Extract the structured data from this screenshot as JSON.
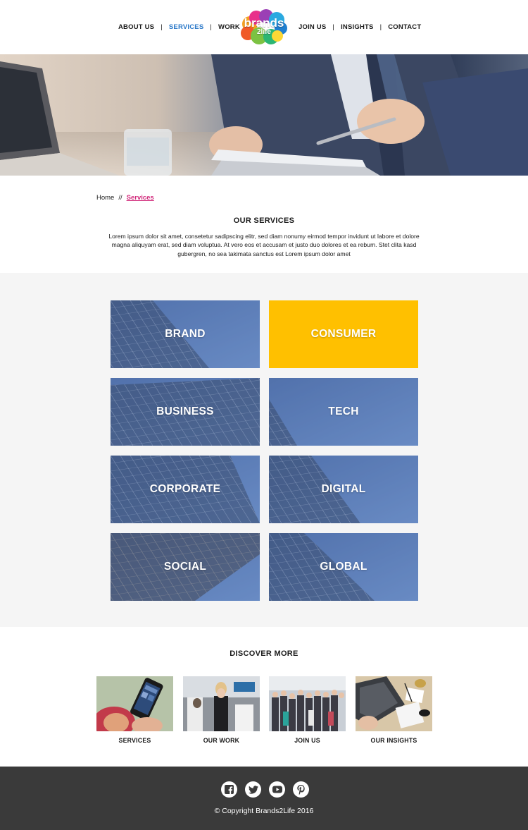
{
  "nav": {
    "left": [
      {
        "label": "ABOUT US",
        "active": false
      },
      {
        "label": "SERVICES",
        "active": true
      },
      {
        "label": "WORK",
        "active": false
      }
    ],
    "right": [
      {
        "label": "JOIN US",
        "active": false
      },
      {
        "label": "INSIGHTS",
        "active": false
      },
      {
        "label": "CONTACT",
        "active": false
      }
    ],
    "separator": "|",
    "active_color": "#2a78c8"
  },
  "logo": {
    "line1": "brands",
    "line2": "2life"
  },
  "breadcrumb": {
    "home": "Home",
    "separator": "//",
    "current": "Services",
    "current_color": "#d1287a"
  },
  "services_intro": {
    "title": "OUR SERVICES",
    "body": "Lorem ipsum dolor sit amet, consetetur sadipscing elitr, sed diam nonumy eirmod tempor invidunt ut labore et dolore magna aliquyam erat, sed diam voluptua. At vero eos et accusam et justo duo dolores et ea rebum. Stet clita kasd gubergren, no sea takimata sanctus est Lorem ipsum dolor amet"
  },
  "services": [
    {
      "label": "BRAND"
    },
    {
      "label": "CONSUMER",
      "color": "#ffc000"
    },
    {
      "label": "BUSINESS"
    },
    {
      "label": "TECH"
    },
    {
      "label": "CORPORATE"
    },
    {
      "label": "DIGITAL"
    },
    {
      "label": "SOCIAL"
    },
    {
      "label": "GLOBAL"
    }
  ],
  "discover": {
    "title": "DISCOVER MORE",
    "items": [
      {
        "label": "SERVICES"
      },
      {
        "label": "OUR WORK"
      },
      {
        "label": "JOIN US"
      },
      {
        "label": "OUR INSIGHTS"
      }
    ]
  },
  "footer": {
    "social": [
      {
        "icon": "facebook-icon"
      },
      {
        "icon": "twitter-icon"
      },
      {
        "icon": "youtube-icon"
      },
      {
        "icon": "pinterest-icon"
      }
    ],
    "copyright": "© Copyright Brands2Life 2016",
    "background": "#3a3a3a"
  }
}
